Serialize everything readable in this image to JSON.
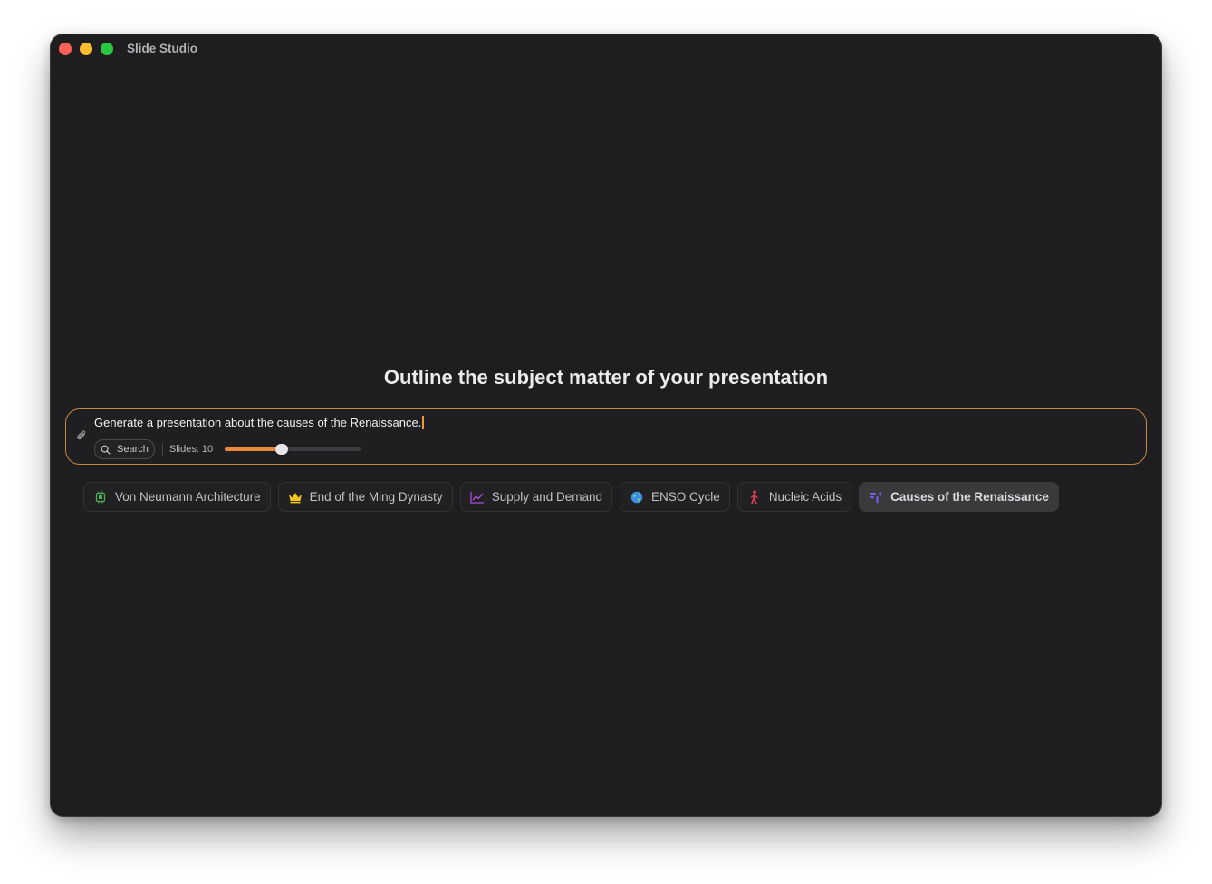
{
  "window": {
    "title": "Slide Studio"
  },
  "main": {
    "heading": "Outline the subject matter of your presentation",
    "prompt": {
      "value": "Generate a presentation about the causes of the Renaissance.",
      "search_label": "Search",
      "slides_label": "Slides: 10",
      "slides_count": 10,
      "slider_fraction": 0.42
    },
    "suggestions": [
      {
        "label": "Von Neumann Architecture",
        "icon": "cpu-chip-icon",
        "color": "#4caf50"
      },
      {
        "label": "End of the Ming Dynasty",
        "icon": "crown-icon",
        "color": "#f5c518"
      },
      {
        "label": "Supply and Demand",
        "icon": "line-chart-icon",
        "color": "#a34fd9"
      },
      {
        "label": "ENSO Cycle",
        "icon": "globe-icon",
        "color": "#3a8ee6"
      },
      {
        "label": "Nucleic Acids",
        "icon": "person-walking-icon",
        "color": "#e0405a"
      },
      {
        "label": "Causes of the Renaissance",
        "icon": "chart-bars-icon",
        "color": "#7b5cf0",
        "active": true
      }
    ]
  },
  "colors": {
    "accent": "#e8893a",
    "window_bg": "#1e1e20"
  }
}
